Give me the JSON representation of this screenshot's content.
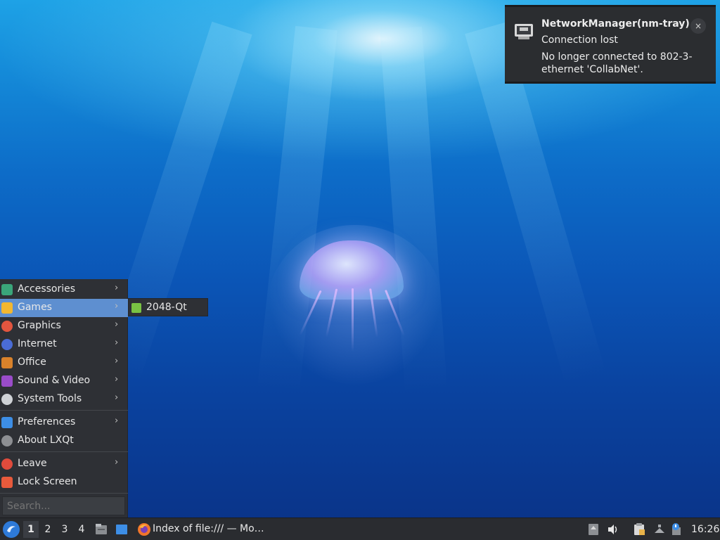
{
  "notification": {
    "app": "NetworkManager(nm-tray)",
    "summary": "Connection lost",
    "body": "No longer connected to 802-3-ethernet 'CollabNet'.",
    "close_icon": "×",
    "icon": "network-wired-icon"
  },
  "menu": {
    "items": [
      {
        "label": "Accessories",
        "icon": "accessories-icon",
        "submenu": true,
        "icon_color": "#3aa57a"
      },
      {
        "label": "Games",
        "icon": "games-icon",
        "submenu": true,
        "icon_color": "#f2b731",
        "selected": true
      },
      {
        "label": "Graphics",
        "icon": "graphics-icon",
        "submenu": true,
        "icon_color": "#e2553f"
      },
      {
        "label": "Internet",
        "icon": "internet-icon",
        "submenu": true,
        "icon_color": "#4a6cd6"
      },
      {
        "label": "Office",
        "icon": "office-icon",
        "submenu": true,
        "icon_color": "#d9822b"
      },
      {
        "label": "Sound & Video",
        "icon": "sound-video-icon",
        "submenu": true,
        "icon_color": "#9a4cc9"
      },
      {
        "label": "System Tools",
        "icon": "system-tools-icon",
        "submenu": true,
        "icon_color": "#cfd2d6"
      },
      {
        "label": "Preferences",
        "icon": "preferences-icon",
        "submenu": true,
        "icon_color": "#3d8ee6"
      },
      {
        "label": "About LXQt",
        "icon": "info-icon",
        "submenu": false,
        "icon_color": "#8d8f93"
      },
      {
        "label": "Leave",
        "icon": "power-icon",
        "submenu": true,
        "icon_color": "#e04b3c"
      },
      {
        "label": "Lock Screen",
        "icon": "lock-icon",
        "submenu": false,
        "icon_color": "#e85a3c"
      }
    ],
    "arrow": "›",
    "search_placeholder": "Search..."
  },
  "submenu": {
    "items": [
      {
        "label": "2048-Qt",
        "icon": "2048-qt-icon",
        "icon_color": "#79c243"
      }
    ]
  },
  "taskbar": {
    "desktops": [
      "1",
      "2",
      "3",
      "4"
    ],
    "active_desktop": "1",
    "task_label": "Index of file:/// — Mo…",
    "clock": "16:26"
  },
  "colors": {
    "menu_bg": "#2e3035",
    "selected": "#5e8fd0",
    "taskbar_bg": "#2a2c30",
    "notification_bg": "#2b2d30"
  }
}
